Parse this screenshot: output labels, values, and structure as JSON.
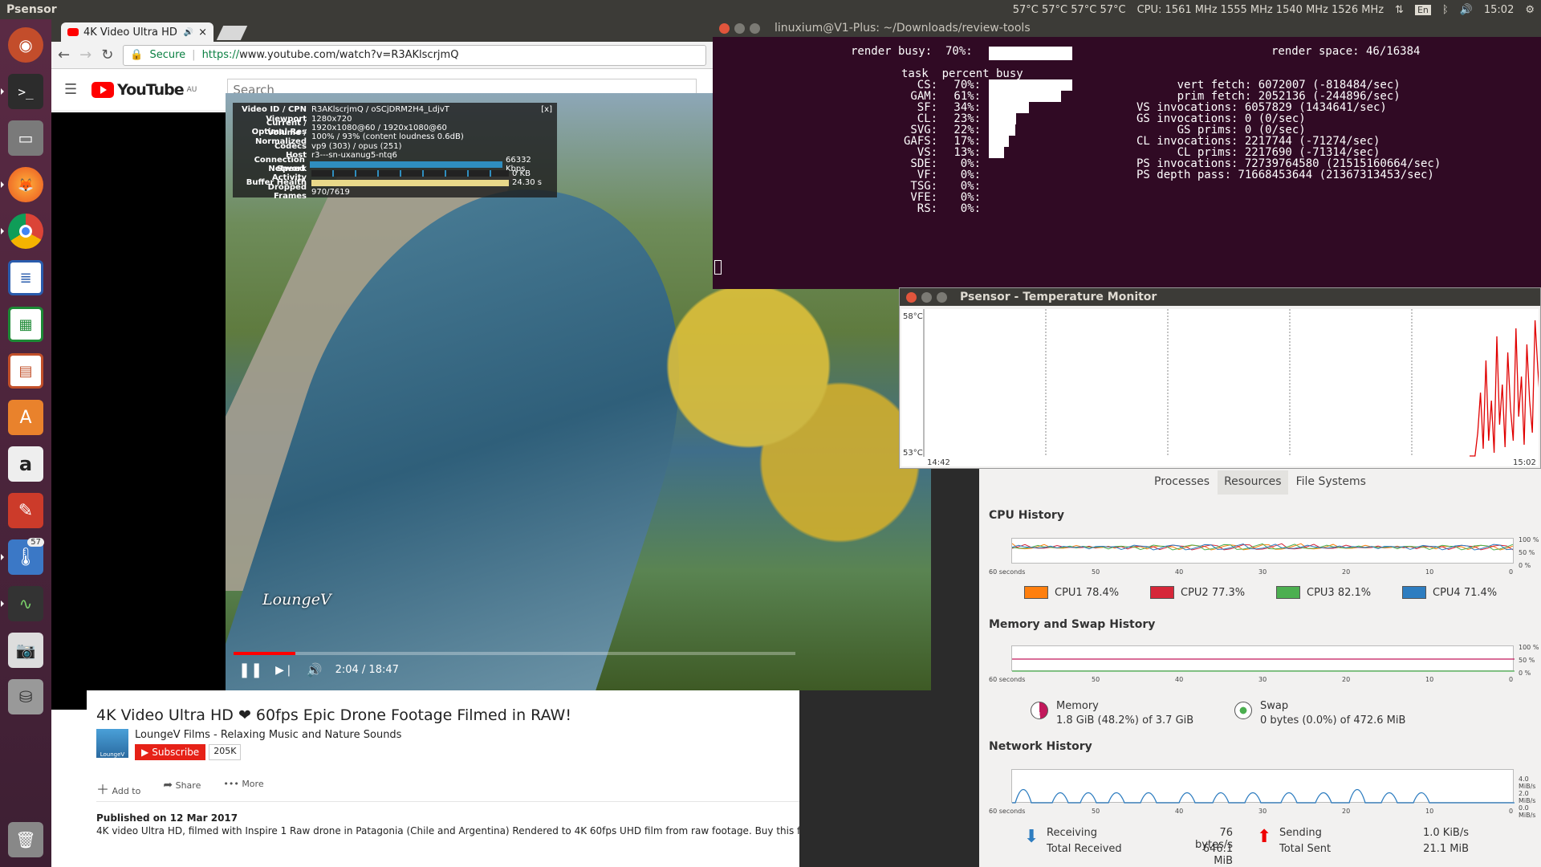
{
  "topbar": {
    "app": "Psensor",
    "temps": "57°C 57°C 57°C 57°C",
    "cpu": "CPU: 1561 MHz 1555 MHz 1540 MHz 1526 MHz",
    "lang": "En",
    "time": "15:02"
  },
  "launcher": {
    "items": [
      "ubuntu-dash",
      "terminal",
      "files",
      "firefox",
      "chromium",
      "writer",
      "calc",
      "impress",
      "software-center",
      "amazon",
      "settings",
      "psensor",
      "system-monitor",
      "screenshot",
      "drive",
      "trash"
    ],
    "psensor_badge": "57"
  },
  "browser": {
    "tab_title": "4K Video Ultra HD",
    "secure_label": "Secure",
    "url_scheme": "https://",
    "url_rest": "www.youtube.com/watch?v=R3AKlscrjmQ",
    "yt_logo": "YouTube",
    "yt_region": "AU",
    "search_placeholder": "Search"
  },
  "stats": {
    "rows": [
      {
        "k": "Video ID / CPN",
        "v": "R3AKlscrjmQ / oSCjDRM2H4_LdjvT"
      },
      {
        "k": "Viewport",
        "v": "1280x720"
      },
      {
        "k": "Current / Optimal Res",
        "v": "1920x1080@60 / 1920x1080@60"
      },
      {
        "k": "Volume / Normalized",
        "v": "100% / 93% (content loudness 0.6dB)"
      },
      {
        "k": "Codecs",
        "v": "vp9 (303) / opus (251)"
      },
      {
        "k": "Host",
        "v": "r3---sn-uxanug5-ntq6"
      },
      {
        "k": "Connection Speed",
        "v": "66332 Kbps"
      },
      {
        "k": "Network Activity",
        "v": "0 KB"
      },
      {
        "k": "Buffer Health",
        "v": "24.30 s"
      },
      {
        "k": "Dropped Frames",
        "v": "970/7619"
      }
    ],
    "close": "[x]"
  },
  "player": {
    "watermark": "LoungeV",
    "time": "2:04 / 18:47",
    "progress": 0.11
  },
  "video_info": {
    "title": "4K Video Ultra HD ❤ 60fps Epic Drone Footage Filmed in RAW!",
    "channel": "LoungeV Films - Relaxing Music and Nature Sounds",
    "channel_logo": "LoungeV",
    "subscribe": "Subscribe",
    "subs": "205K",
    "add_to": "Add to",
    "share": "Share",
    "more": "More",
    "published": "Published on 12 Mar 2017",
    "description": "4K video Ultra HD, filmed with Inspire 1 Raw drone in Patagonia (Chile and Argentina) Rendered to 4K 60fps UHD film from raw footage. Buy this film here: http://www.loungev.com/incredible"
  },
  "terminal": {
    "title": "linuxium@V1-Plus: ~/Downloads/review-tools",
    "render_busy": "render busy:  70%:",
    "render_space": "render space: 46/16384",
    "header": "task  percent busy",
    "tasks": [
      {
        "name": "CS:",
        "pct": "70%:",
        "fill": 0.7
      },
      {
        "name": "GAM:",
        "pct": "61%:",
        "fill": 0.61
      },
      {
        "name": "SF:",
        "pct": "34%:",
        "fill": 0.34
      },
      {
        "name": "CL:",
        "pct": "23%:",
        "fill": 0.23
      },
      {
        "name": "SVG:",
        "pct": "22%:",
        "fill": 0.22
      },
      {
        "name": "GAFS:",
        "pct": "17%:",
        "fill": 0.17
      },
      {
        "name": "VS:",
        "pct": "13%:",
        "fill": 0.13
      },
      {
        "name": "SDE:",
        "pct": "0%:",
        "fill": 0
      },
      {
        "name": "VF:",
        "pct": "0%:",
        "fill": 0
      },
      {
        "name": "TSG:",
        "pct": "0%:",
        "fill": 0
      },
      {
        "name": "VFE:",
        "pct": "0%:",
        "fill": 0
      },
      {
        "name": "RS:",
        "pct": "0%:",
        "fill": 0
      }
    ],
    "render_fill": 0.7,
    "stats": [
      "      vert fetch: 6072007 (-818484/sec)",
      "      prim fetch: 2052136 (-244896/sec)",
      "VS invocations: 6057829 (1434641/sec)",
      "GS invocations: 0 (0/sec)",
      "      GS prims: 0 (0/sec)",
      "CL invocations: 2217744 (-71274/sec)",
      "      CL prims: 2217690 (-71314/sec)",
      "PS invocations: 72739764580 (21515160664/sec)",
      "PS depth pass: 71668453644 (21367313453/sec)"
    ]
  },
  "psensor": {
    "title": "Psensor - Temperature Monitor",
    "ymax": "58°C",
    "ymin": "53°C",
    "xstart": "14:42",
    "xend": "15:02",
    "series_color": "#e00000"
  },
  "sysmon": {
    "tabs": [
      "Processes",
      "Resources",
      "File Systems"
    ],
    "active_tab": "Resources",
    "cpu_title": "CPU History",
    "mem_title": "Memory and Swap History",
    "net_title": "Network History",
    "xticks": [
      "60 seconds",
      "50",
      "40",
      "30",
      "20",
      "10",
      "0"
    ],
    "pct_ticks": [
      "100 %",
      "50 %",
      "0 %"
    ],
    "net_ticks": [
      "4.0 MiB/s",
      "2.0 MiB/s",
      "0.0 MiB/s"
    ],
    "cpus": [
      {
        "label": "CPU1  78.4%",
        "color": "#ff7f0e"
      },
      {
        "label": "CPU2  77.3%",
        "color": "#d62739"
      },
      {
        "label": "CPU3  82.1%",
        "color": "#4caf50"
      },
      {
        "label": "CPU4  71.4%",
        "color": "#2e7dc0"
      }
    ],
    "memory": {
      "label": "Memory",
      "value": "1.8 GiB (48.2%) of 3.7 GiB",
      "pct": 0.482
    },
    "swap": {
      "label": "Swap",
      "value": "0 bytes (0.0%) of 472.6 MiB"
    },
    "net": {
      "receiving": "Receiving",
      "recv_rate": "76 bytes/s",
      "total_received_label": "Total Received",
      "total_received": "646.1 MiB",
      "sending": "Sending",
      "send_rate": "1.0 KiB/s",
      "total_sent_label": "Total Sent",
      "total_sent": "21.1 MiB"
    }
  }
}
